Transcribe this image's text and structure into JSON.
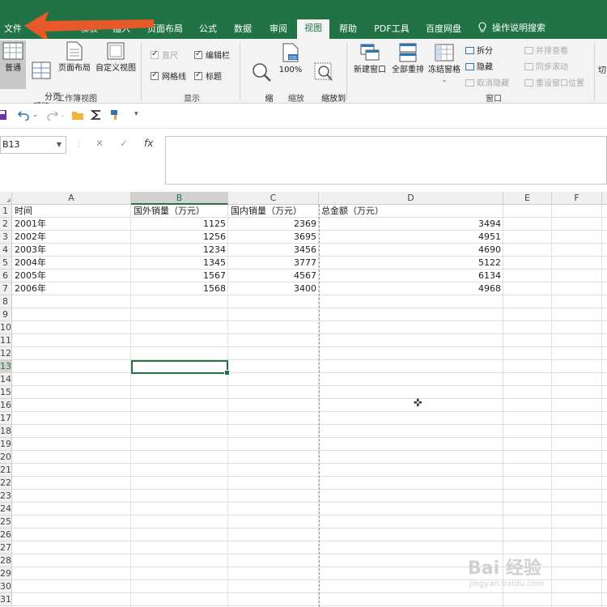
{
  "tabs": [
    {
      "id": "file",
      "label": "文件"
    },
    {
      "id": "start",
      "label": "模板"
    },
    {
      "id": "insert",
      "label": "插入"
    },
    {
      "id": "page_layout",
      "label": "页面布局"
    },
    {
      "id": "formula",
      "label": "公式"
    },
    {
      "id": "data",
      "label": "数据"
    },
    {
      "id": "review",
      "label": "审阅"
    },
    {
      "id": "view",
      "label": "视图",
      "active": true
    },
    {
      "id": "help",
      "label": "帮助"
    },
    {
      "id": "pdf",
      "label": "PDF工具"
    },
    {
      "id": "baidu",
      "label": "百度网盘"
    }
  ],
  "tell_me": "操作说明搜索",
  "ribbon": {
    "workbook_views": {
      "label": "工作簿视图",
      "normal": "普通",
      "page_break": "分页\n预览",
      "page_layout": "页面布局",
      "custom_view": "自定义视图"
    },
    "show": {
      "label": "显示",
      "ruler": "直尺",
      "formula_bar": "编辑栏",
      "gridlines": "网格线",
      "headings": "标题"
    },
    "zoom": {
      "label": "缩放",
      "zoom": "缩\n放",
      "hundred": "100%",
      "zoom_selection": "缩放到\n选定区域"
    },
    "window": {
      "label": "窗口",
      "new_window": "新建窗口",
      "arrange_all": "全部重排",
      "freeze_panes": "冻结窗格",
      "split": "拆分",
      "hide": "隐藏",
      "unhide": "取消隐藏",
      "side_by_side": "并排查看",
      "sync_scroll": "同步滚动",
      "reset_position": "重设窗口位置",
      "switch_windows": "切"
    }
  },
  "name_box": "B13",
  "fx_label": "fx",
  "columns": [
    "A",
    "B",
    "C",
    "D",
    "E",
    "F"
  ],
  "selected_column": "B",
  "selected_row": 13,
  "rows": [
    "1",
    "2",
    "3",
    "4",
    "5",
    "6",
    "7",
    "8",
    "9",
    "10",
    "11",
    "12",
    "13",
    "14",
    "15",
    "16",
    "17",
    "18",
    "19",
    "20",
    "21",
    "22",
    "23",
    "24",
    "25",
    "26",
    "27",
    "28",
    "29",
    "30",
    "31"
  ],
  "sheet": {
    "headers": [
      "时间",
      "国外销量（万元）",
      "国内销量（万元）",
      "总金额（万元）"
    ],
    "data": [
      [
        "2001年",
        "1125",
        "2369",
        "3494"
      ],
      [
        "2002年",
        "1256",
        "3695",
        "4951"
      ],
      [
        "2003年",
        "1234",
        "3456",
        "4690"
      ],
      [
        "2004年",
        "1345",
        "3777",
        "5122"
      ],
      [
        "2005年",
        "1567",
        "4567",
        "6134"
      ],
      [
        "2006年",
        "1568",
        "3400",
        "4968"
      ]
    ]
  },
  "watermark": {
    "text": "Bai 经验",
    "url": "jingyan.baidu.com"
  },
  "colors": {
    "accent": "#217346",
    "arrow": "#e8592a"
  }
}
